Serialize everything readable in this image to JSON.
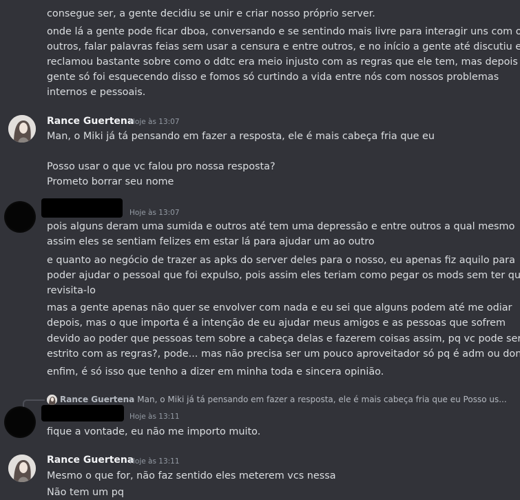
{
  "messages": {
    "top_continuation": [
      "consegue ser, a gente decidiu se unir e criar nosso próprio server.",
      "onde lá a gente pode ficar dboa, conversando e se sentindo mais livre para interagir uns com os",
      "outros, falar palavras feias sem usar a censura e entre outros, e no início a gente até discutiu e",
      "reclamou bastante sobre como o ddtc era meio injusto com as regras que ele tem, mas depois a",
      "gente só foi esquecendo disso e fomos só curtindo a vida entre nós com nossos problemas",
      "internos e pessoais."
    ],
    "rance_1": {
      "author": "Rance Guertena",
      "timestamp": "Hoje às 13:07",
      "lines": [
        "Man, o Miki já tá pensando em fazer a resposta, ele é mais cabeça fria que eu",
        "Posso usar o que vc falou pro nossa resposta?",
        "Prometo borrar seu nome"
      ]
    },
    "redacted_1": {
      "timestamp": "Hoje às 13:07",
      "lines": [
        "pois alguns deram uma sumida e outros até tem uma depressão e entre outros a qual mesmo",
        "assim eles se sentiam felizes em estar lá para ajudar um ao outro",
        "e quanto ao negócio de trazer as apks do server deles para o nosso, eu apenas fiz aquilo para",
        "poder ajudar o pessoal que foi expulso, pois assim eles teriam como pegar os mods sem ter que",
        "revisita-lo",
        "mas a gente apenas não quer se envolver com nada e eu sei que alguns podem até me odiar",
        "depois, mas o que importa é a intenção de eu ajudar meus amigos e as pessoas que sofrem",
        "devido ao poder que pessoas tem sobre a cabeça delas e fazerem coisas assim, pq vc pode ser",
        "estrito com as regras?, pode... mas não precisa ser um pouco aproveitador só pq é adm ou dono.",
        "enfim, é só isso que tenho a dizer em minha toda e sincera opinião."
      ]
    },
    "redacted_2": {
      "reply_author": "Rance Guertena",
      "reply_preview": "Man, o Miki já tá pensando em fazer a resposta, ele é mais cabeça fria que eu   Posso us...",
      "timestamp": "Hoje às 13:11",
      "lines": [
        "fique a vontade, eu não me importo muito."
      ]
    },
    "rance_2": {
      "author": "Rance Guertena",
      "timestamp": "Hoje às 13:11",
      "lines": [
        "Mesmo o que for, não faz sentido eles meterem vcs nessa",
        "Não tem um pq"
      ]
    }
  }
}
